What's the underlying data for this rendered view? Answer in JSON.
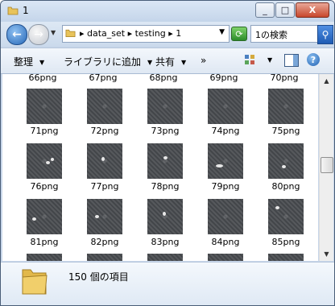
{
  "window": {
    "title": "1",
    "buttons": {
      "minimize": "_",
      "maximize": "□",
      "close": "X"
    }
  },
  "address": {
    "path": "▸ data_set ▸ testing ▸ 1",
    "search_placeholder": "1の検索"
  },
  "toolbar": {
    "organize": "整理",
    "add_to_library": "ライブラリに追加",
    "share": "共有",
    "more": "»"
  },
  "files": {
    "row_labels_top": [
      "66png",
      "67png",
      "68png",
      "69png",
      "70png"
    ],
    "rows": [
      {
        "labels": [
          "71png",
          "72png",
          "73png",
          "74png",
          "75png"
        ]
      },
      {
        "labels": [
          "76png",
          "77png",
          "78png",
          "79png",
          "80png"
        ]
      },
      {
        "labels": [
          "81png",
          "82png",
          "83png",
          "84png",
          "85png"
        ]
      }
    ]
  },
  "details": {
    "count_text": "150 個の項目"
  },
  "icons": {
    "back": "back-arrow-icon",
    "forward": "forward-arrow-icon",
    "refresh": "refresh-icon",
    "search": "search-icon",
    "views": "views-icon",
    "preview": "preview-pane-icon",
    "help": "help-icon"
  }
}
